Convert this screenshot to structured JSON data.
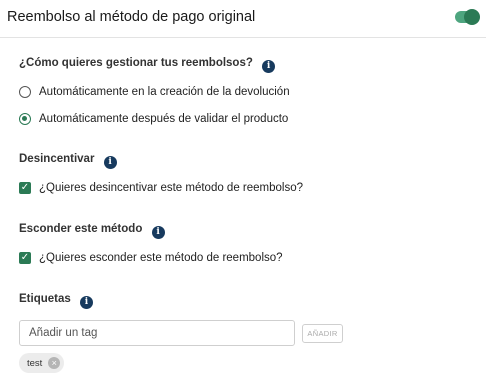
{
  "header": {
    "title": "Reembolso al método de pago original",
    "toggle_on": true
  },
  "refund_management": {
    "title": "¿Cómo quieres gestionar tus reembolsos?",
    "options": [
      {
        "label": "Automáticamente en la creación de la devolución",
        "selected": false
      },
      {
        "label": "Automáticamente después de validar el producto",
        "selected": true
      }
    ]
  },
  "discourage": {
    "title": "Desincentivar",
    "checkbox_label": "¿Quieres desincentivar este método de reembolso?",
    "checked": true
  },
  "hide_method": {
    "title": "Esconder este método",
    "checkbox_label": "¿Quieres esconder este método de reembolso?",
    "checked": true
  },
  "tags": {
    "title": "Etiquetas",
    "input_placeholder": "Añadir un tag",
    "add_button_label": "AÑADIR",
    "items": [
      {
        "label": "test"
      }
    ]
  },
  "icons": {
    "info": "info-icon",
    "check": "check-icon",
    "remove": "close-icon",
    "info_glyph": "i",
    "check_glyph": "✓",
    "remove_glyph": "×"
  },
  "colors": {
    "accent": "#2b7a55",
    "toggle_track": "#4ea57f",
    "info_icon": "#173a5e"
  }
}
